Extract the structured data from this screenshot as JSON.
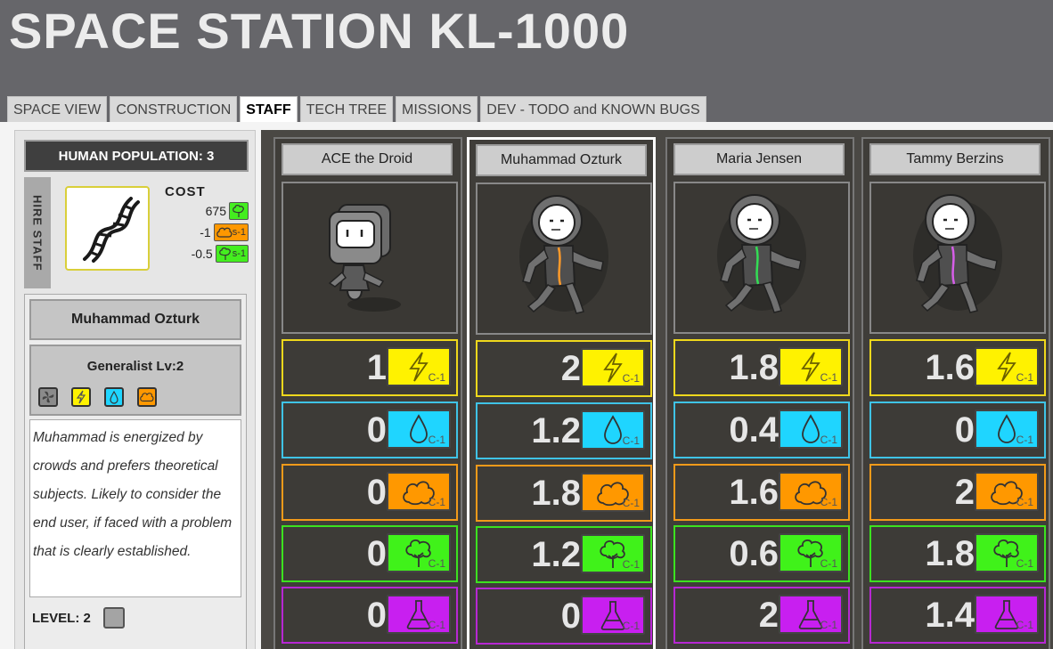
{
  "title": "SPACE STATION KL-1000",
  "tabs": [
    {
      "label": "SPACE VIEW",
      "active": false
    },
    {
      "label": "CONSTRUCTION",
      "active": false
    },
    {
      "label": "STAFF",
      "active": true
    },
    {
      "label": "TECH TREE",
      "active": false
    },
    {
      "label": "MISSIONS",
      "active": false
    },
    {
      "label": "DEV - TODO and KNOWN BUGS",
      "active": false
    }
  ],
  "left_panel": {
    "population_label": "HUMAN POPULATION: 3",
    "hire_label": "HIRE STAFF",
    "cost": {
      "title": "COST",
      "rows": [
        {
          "value": "675",
          "icon": "tree-icon",
          "suffix": ""
        },
        {
          "value": "-1",
          "icon": "cloud-icon",
          "suffix": "s-1"
        },
        {
          "value": "-0.5",
          "icon": "tree-icon",
          "suffix": "s-1"
        }
      ]
    },
    "selected": {
      "name": "Muhammad Ozturk",
      "class_label": "Generalist Lv:2",
      "traits": [
        "fan-icon",
        "lightning-icon",
        "droplet-icon",
        "cloud-icon"
      ],
      "description": "Muhammad is energized by crowds and prefers theoretical subjects. Likely to consider the end user, if faced with a problem that is clearly established.",
      "level_label": "LEVEL: 2"
    }
  },
  "resource_suffix": "C-1",
  "colors": {
    "energy": "#fff200",
    "water": "#1fd5ff",
    "heat": "#ff9800",
    "bio": "#40f21a",
    "science": "#c81ff0"
  },
  "staff": [
    {
      "name": "ACE the Droid",
      "kind": "droid",
      "stats": {
        "energy": "1",
        "water": "0",
        "heat": "0",
        "bio": "0",
        "science": "0"
      }
    },
    {
      "name": "Muhammad Ozturk",
      "kind": "human",
      "accent": "#ff9a2a",
      "selected": true,
      "stats": {
        "energy": "2",
        "water": "1.2",
        "heat": "1.8",
        "bio": "1.2",
        "science": "0"
      }
    },
    {
      "name": "Maria Jensen",
      "kind": "human",
      "accent": "#33dd55",
      "stats": {
        "energy": "1.8",
        "water": "0.4",
        "heat": "1.6",
        "bio": "0.6",
        "science": "2"
      }
    },
    {
      "name": "Tammy Berzins",
      "kind": "human",
      "accent": "#d65ee8",
      "stats": {
        "energy": "1.6",
        "water": "0",
        "heat": "2",
        "bio": "1.8",
        "science": "1.4"
      }
    }
  ]
}
